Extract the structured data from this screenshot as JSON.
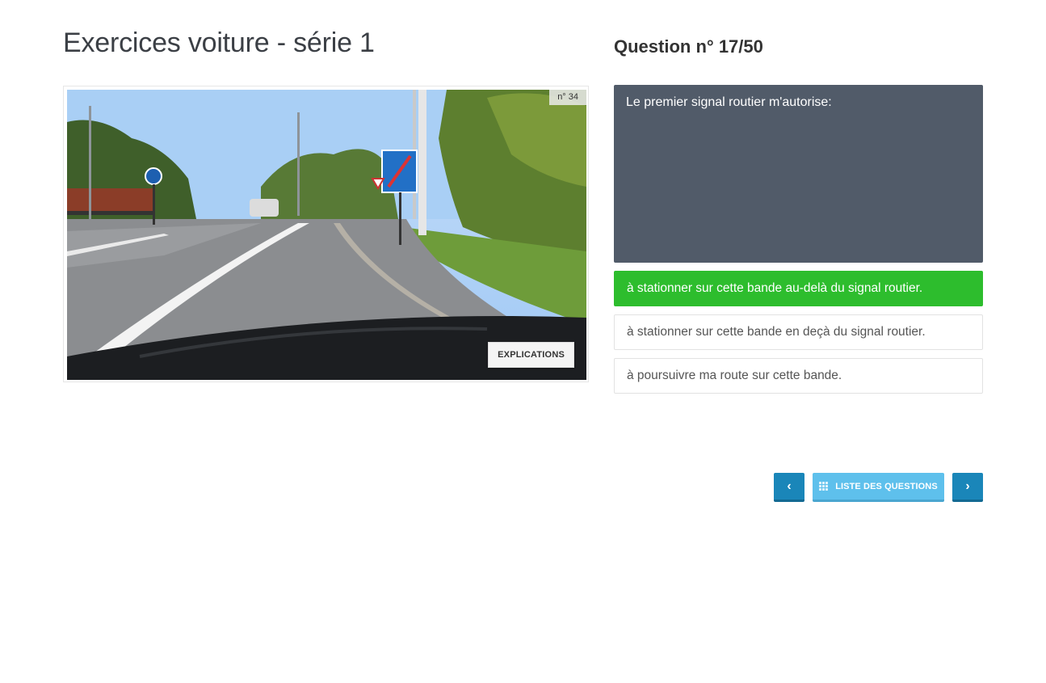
{
  "page": {
    "title": "Exercices voiture - série 1"
  },
  "question": {
    "label": "Question n°",
    "counter": "17/50",
    "text": "Le premier signal routier m'autorise:"
  },
  "photo": {
    "number": "n° 34",
    "explanations_label": "EXPLICATIONS"
  },
  "answers": [
    {
      "text": "à stationner sur cette bande au-delà du signal routier.",
      "selected": true
    },
    {
      "text": "à stationner sur cette bande en deçà du signal routier.",
      "selected": false
    },
    {
      "text": "à poursuivre ma route sur cette bande.",
      "selected": false
    }
  ],
  "navigation": {
    "prev_icon": "chevron-left-icon",
    "next_icon": "chevron-right-icon",
    "list_label": "LISTE DES QUESTIONS",
    "list_icon": "grid-icon"
  },
  "colors": {
    "question_bg": "#515b69",
    "selected_answer": "#2dbd2d",
    "nav_button": "#1a86b9",
    "list_button": "#5ec0ec"
  }
}
